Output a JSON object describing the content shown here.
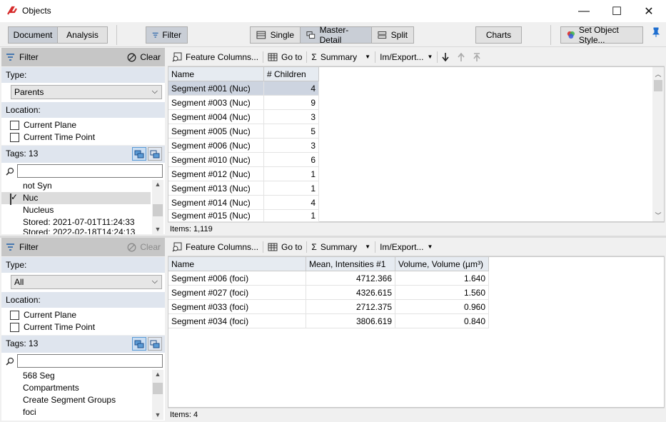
{
  "window": {
    "title": "Objects",
    "minimize": "—",
    "maximize": "☐",
    "close": "✕"
  },
  "toolbar": {
    "document": "Document",
    "analysis": "Analysis",
    "filter": "Filter",
    "single": "Single",
    "master_detail": "Master-Detail",
    "split": "Split",
    "charts": "Charts",
    "set_style": "Set Object Style..."
  },
  "top_filter": {
    "header": "Filter",
    "clear": "Clear",
    "type_label": "Type:",
    "type_value": "Parents",
    "location_label": "Location:",
    "current_plane": "Current Plane",
    "current_time": "Current Time Point",
    "tags_label": "Tags: 13",
    "tags": [
      {
        "label": "not Syn",
        "checked": false
      },
      {
        "label": "Nuc",
        "checked": true
      },
      {
        "label": "Nucleus",
        "checked": false
      },
      {
        "label": "Stored: 2021-07-01T11:24:33",
        "checked": false
      },
      {
        "label": "Stored: 2022-02-18T14:24:13",
        "checked": false
      }
    ]
  },
  "bottom_filter": {
    "header": "Filter",
    "clear": "Clear",
    "type_label": "Type:",
    "type_value": "All",
    "location_label": "Location:",
    "current_plane": "Current Plane",
    "current_time": "Current Time Point",
    "tags_label": "Tags: 13",
    "tags": [
      {
        "label": "568 Seg"
      },
      {
        "label": "Compartments"
      },
      {
        "label": "Create Segment Groups"
      },
      {
        "label": "foci"
      }
    ]
  },
  "master_toolbar": {
    "feature_columns": "Feature Columns...",
    "goto": "Go to",
    "summary": "Summary",
    "im_export": "Im/Export..."
  },
  "master_table": {
    "columns": [
      "Name",
      "# Children"
    ],
    "rows": [
      [
        "Segment #001 (Nuc)",
        "4"
      ],
      [
        "Segment #003 (Nuc)",
        "9"
      ],
      [
        "Segment #004 (Nuc)",
        "3"
      ],
      [
        "Segment #005 (Nuc)",
        "5"
      ],
      [
        "Segment #006 (Nuc)",
        "3"
      ],
      [
        "Segment #010 (Nuc)",
        "6"
      ],
      [
        "Segment #012 (Nuc)",
        "1"
      ],
      [
        "Segment #013 (Nuc)",
        "1"
      ],
      [
        "Segment #014 (Nuc)",
        "4"
      ],
      [
        "Segment #015 (Nuc)",
        "1"
      ]
    ],
    "items": "Items: 1,119"
  },
  "detail_toolbar": {
    "feature_columns": "Feature Columns...",
    "goto": "Go to",
    "summary": "Summary",
    "im_export": "Im/Export..."
  },
  "detail_table": {
    "columns": [
      "Name",
      "Mean, Intensities #1",
      "Volume, Volume (µm³)"
    ],
    "rows": [
      [
        "Segment #006 (foci)",
        "4712.366",
        "1.640"
      ],
      [
        "Segment #027 (foci)",
        "4326.615",
        "1.560"
      ],
      [
        "Segment #033 (foci)",
        "2712.375",
        "0.960"
      ],
      [
        "Segment #034 (foci)",
        "3806.619",
        "0.840"
      ]
    ],
    "items": "Items: 4"
  }
}
